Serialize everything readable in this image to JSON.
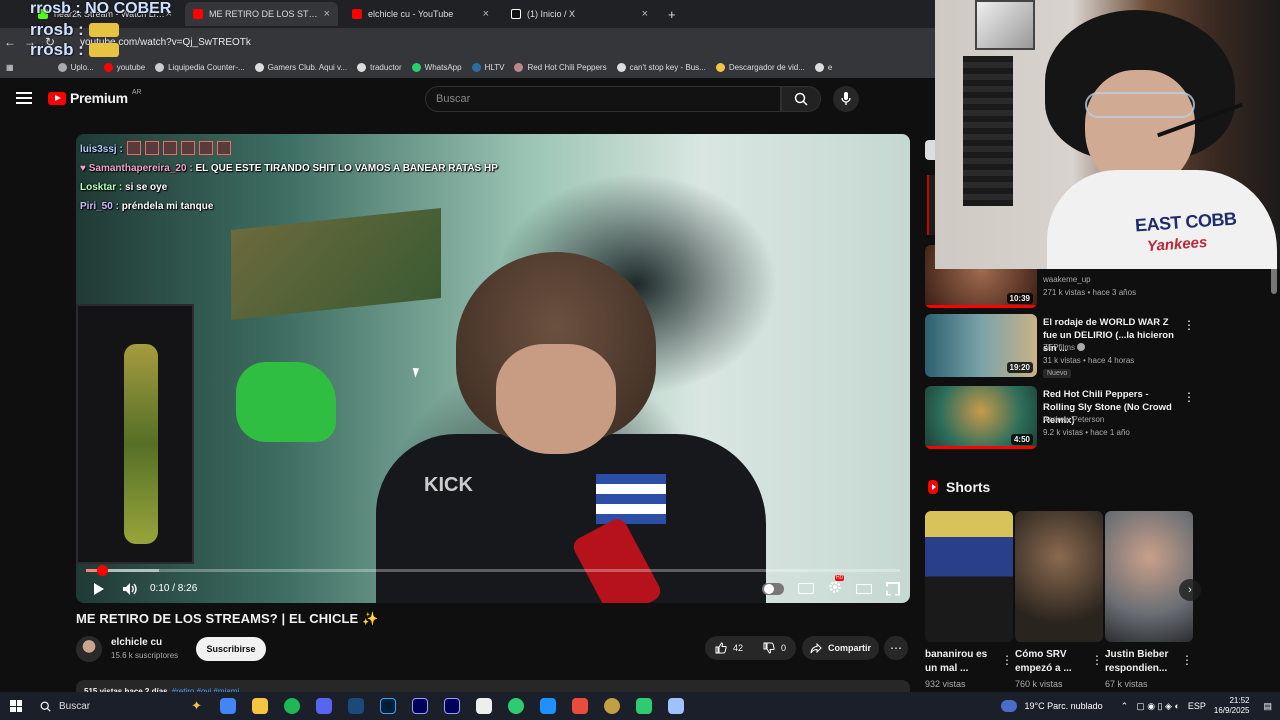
{
  "overlay_chat": {
    "line1": "rrosb : NO COBER",
    "line2_user": "rrosb :",
    "line3_user": "rrosb :"
  },
  "browser": {
    "tabs": [
      {
        "label": "near2k Stream - Watch Live on",
        "color": "#53fc18"
      },
      {
        "label": "ME RETIRO DE LOS STREAMS?",
        "color": "#ff0000"
      },
      {
        "label": "elchicle cu - YouTube",
        "color": "#ff0000"
      },
      {
        "label": "(1) Inicio / X",
        "color": "#ffffff"
      }
    ],
    "new_tab": "+",
    "url": "youtube.com/watch?v=Qj_SwTREOTk",
    "bookmarks": [
      {
        "label": "Uplo...",
        "color": "#aaaaaa"
      },
      {
        "label": "youtube",
        "color": "#ff0000"
      },
      {
        "label": "Liquipedia Counter-...",
        "color": "#cccccc"
      },
      {
        "label": "Gamers Club. Aqui v...",
        "color": "#dddddd"
      },
      {
        "label": "traductor",
        "color": "#dddddd"
      },
      {
        "label": "WhatsApp",
        "color": "#25d366"
      },
      {
        "label": "HLTV",
        "color": "#2d6da3"
      },
      {
        "label": "Red Hot Chili Peppers",
        "color": "#b88"
      },
      {
        "label": "can't stop key - Bus...",
        "color": "#dddddd"
      },
      {
        "label": "Descargador de vid...",
        "color": "#f5c542"
      },
      {
        "label": "e",
        "color": "#dddddd"
      }
    ]
  },
  "youtube": {
    "logo_text": "Premium",
    "logo_region": "AR",
    "search_placeholder": "Buscar"
  },
  "player": {
    "chat": [
      {
        "user": "luis3ssj :",
        "msg": ""
      },
      {
        "user": "Samanthapereira_20 :",
        "msg": "EL QUE ESTE TIRANDO SHIT LO VAMOS A BANEAR RATAS HP"
      },
      {
        "user": "Losktar :",
        "msg": "si se oye"
      },
      {
        "user": "Piri_50 :",
        "msg": "préndela mi tanque"
      }
    ],
    "shirt_text": "KICK",
    "time": "0:10 / 8:26",
    "progress_fraction": 0.0198,
    "loaded_fraction": 0.09
  },
  "video": {
    "title": "ME RETIRO DE LOS STREAMS? | EL CHICLE ✨",
    "channel": "elchicle cu",
    "subscribers": "15.6 k suscriptores",
    "subscribe_label": "Suscribirse",
    "likes": "42",
    "dislikes": "0",
    "share_label": "Compartir",
    "description_meta": "515 vistas  hace 2 días",
    "description_tags": "#retiro #ovi #miami"
  },
  "sidebar": {
    "items": [
      {
        "title": "",
        "channel": "waakeme_up",
        "meta": "271 k vistas • hace 3 años",
        "duration": "10:39",
        "thumb": "#5b3a2e",
        "watched": 1.0,
        "badge": ""
      },
      {
        "title": "El rodaje de WORLD WAR Z fue un DELIRIO (...la hicieron sin ...",
        "channel": "ZEPfilms",
        "meta": "31 k vistas • hace 4 horas",
        "duration": "19:20",
        "thumb": "#3c6a7a",
        "watched": 0,
        "badge": "Nuevo"
      },
      {
        "title": "Red Hot Chili Peppers - Rolling Sly Stone (No Crowd Remix)",
        "channel": "Andrew Peterson",
        "meta": "9.2 k vistas • hace 1 año",
        "duration": "4:50",
        "thumb": "#2d6e5b",
        "watched": 1.0,
        "badge": ""
      }
    ],
    "shorts_title": "Shorts",
    "shorts": [
      {
        "title": "bananirou es un mal ...",
        "views": "932 vistas",
        "thumb": "#2a3f8a"
      },
      {
        "title": "Cómo SRV empezó a ...",
        "views": "760 k vistas",
        "thumb": "#4a4035"
      },
      {
        "title": "Justin Bieber respondien...",
        "views": "67 k vistas",
        "thumb": "#a8b0b8"
      }
    ]
  },
  "webcam": {
    "shirt_line1": "EAST COBB",
    "shirt_line2": "Yankees"
  },
  "taskbar": {
    "search_label": "Buscar",
    "apps": [
      "#4285f4",
      "#f5c542",
      "#1db954",
      "#5865f2",
      "#1b2838",
      "#31a8ff",
      "#9999ff",
      "#9999ff",
      "#ffffff",
      "#2ecc71",
      "#1e90ff",
      "#e74c3c",
      "#c0a040",
      "#2ecc71",
      "#a0c0ff"
    ],
    "weather": "19°C  Parc. nublado",
    "lang": "ESP",
    "time": "21:52",
    "date": "16/9/2025"
  }
}
